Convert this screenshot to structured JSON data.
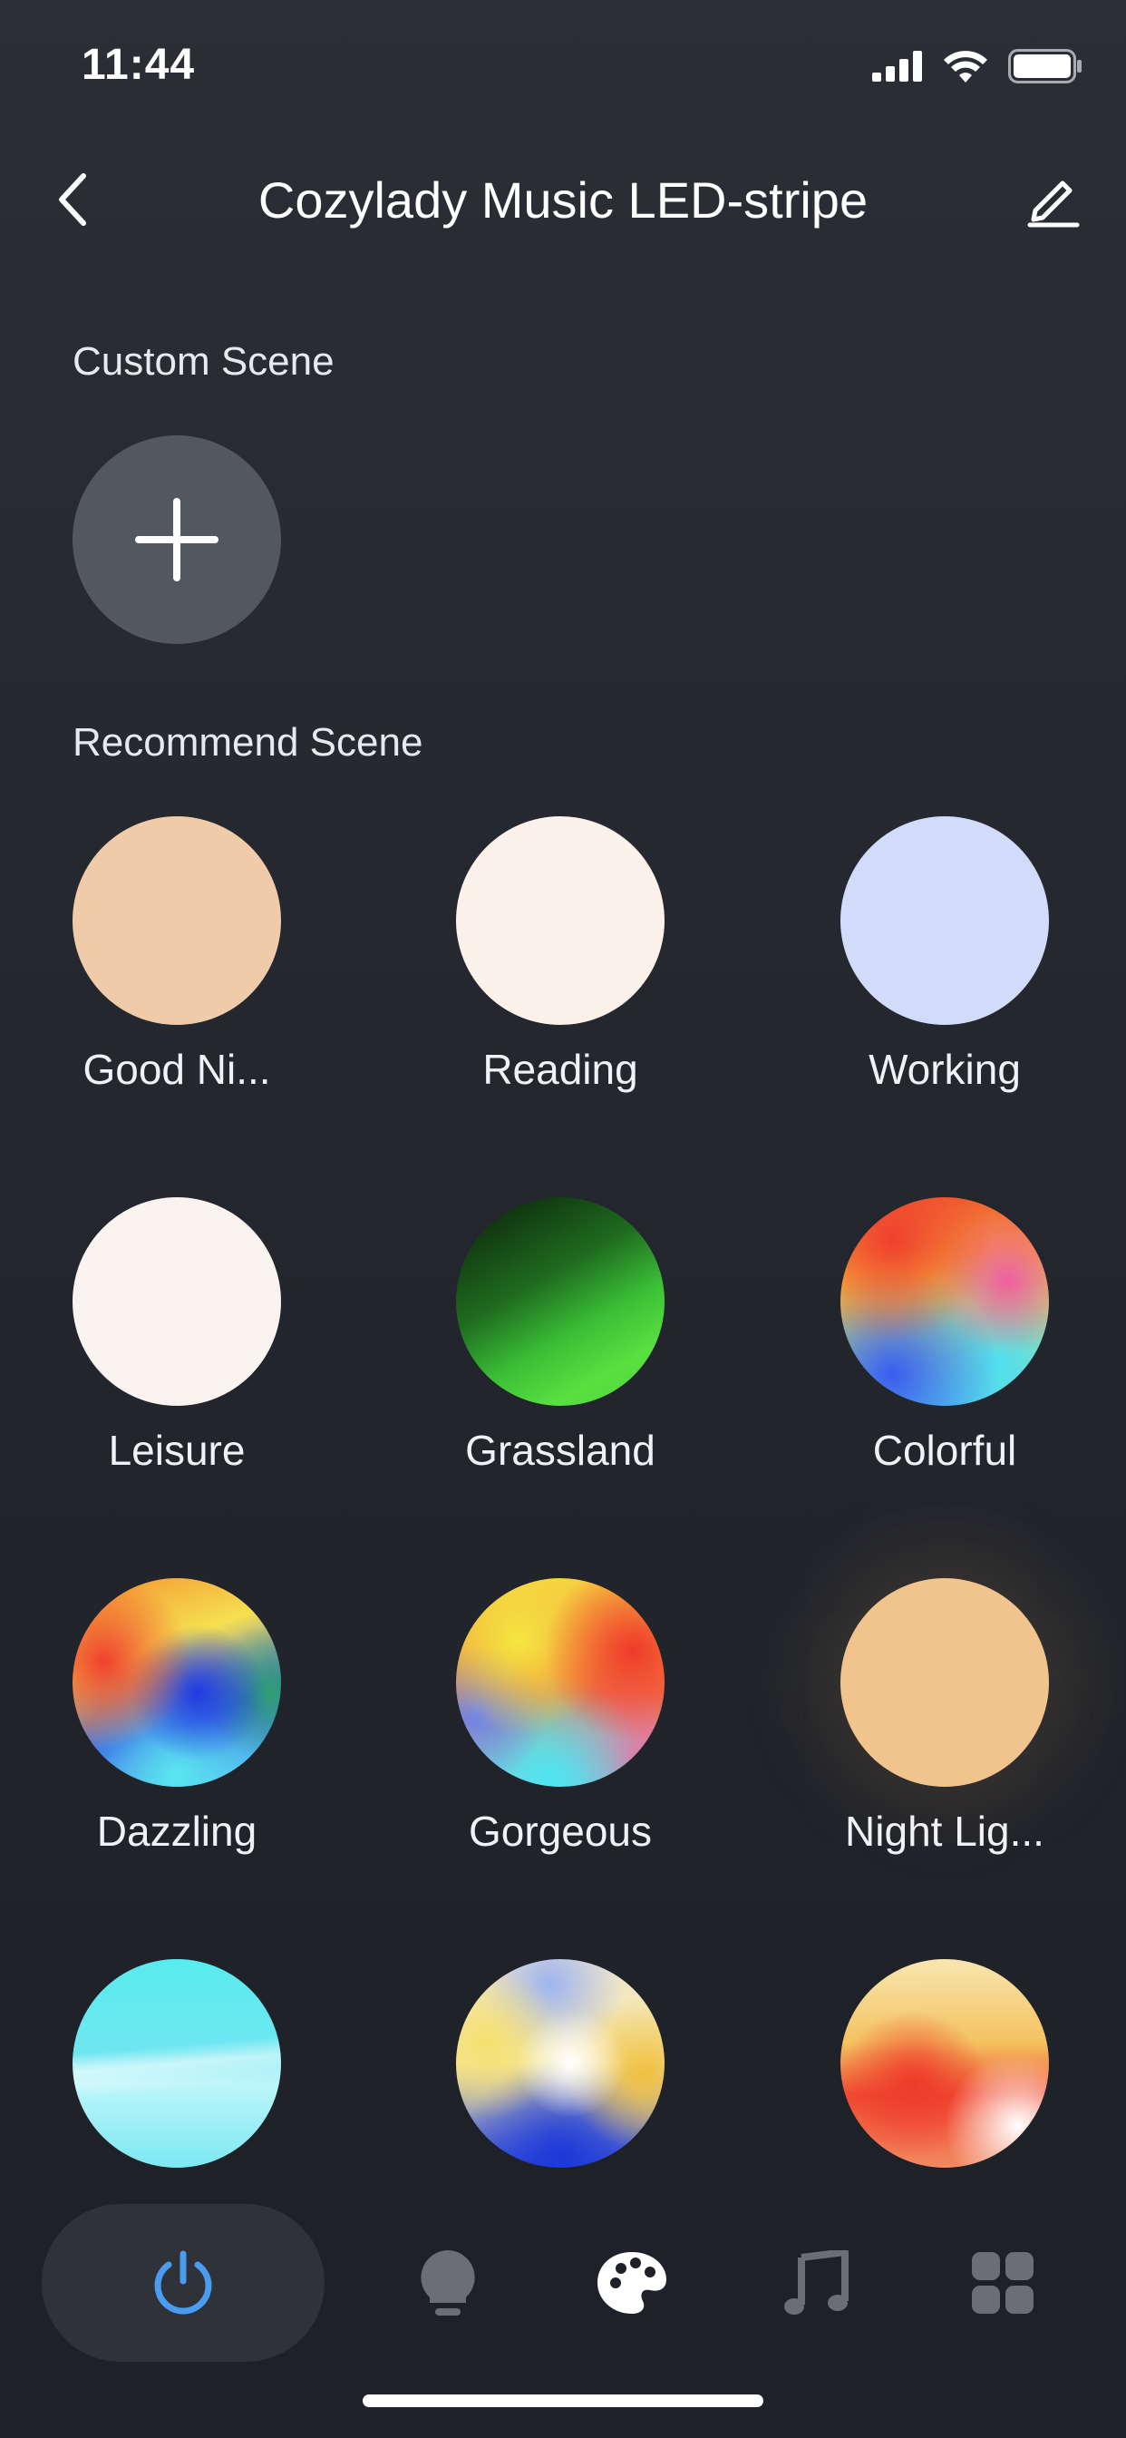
{
  "status_bar": {
    "time": "11:44"
  },
  "nav": {
    "title": "Cozylady Music LED-stripe"
  },
  "custom_section": {
    "label": "Custom Scene"
  },
  "recommend_section": {
    "label": "Recommend Scene"
  },
  "scenes": [
    {
      "label": "Good Ni...",
      "icon": "warm-peach-circle"
    },
    {
      "label": "Reading",
      "icon": "cream-white-circle"
    },
    {
      "label": "Working",
      "icon": "cool-blue-circle"
    },
    {
      "label": "Leisure",
      "icon": "soft-white-circle"
    },
    {
      "label": "Grassland",
      "icon": "green-gradient-circle"
    },
    {
      "label": "Colorful",
      "icon": "rainbow-gradient-circle"
    },
    {
      "label": "Dazzling",
      "icon": "rainbow-blue-gradient-circle"
    },
    {
      "label": "Gorgeous",
      "icon": "rainbow-yellow-gradient-circle"
    },
    {
      "label": "Night Lig...",
      "icon": "amber-circle"
    },
    {
      "label": "",
      "icon": "cyan-gradient-circle"
    },
    {
      "label": "",
      "icon": "white-blue-gradient-circle"
    },
    {
      "label": "",
      "icon": "yellow-red-gradient-circle"
    }
  ],
  "tabs": [
    {
      "name": "power",
      "icon": "power-icon",
      "active_color": "#4a9cf0"
    },
    {
      "name": "white-light",
      "icon": "bulb-icon"
    },
    {
      "name": "scene",
      "icon": "palette-icon"
    },
    {
      "name": "music",
      "icon": "music-note-icon"
    },
    {
      "name": "more",
      "icon": "grid-icon"
    }
  ],
  "colors": {
    "background": "#26292f",
    "add_button": "#535760",
    "active_tab": "#4a9cf0",
    "inactive_tab": "#6b6e74"
  }
}
